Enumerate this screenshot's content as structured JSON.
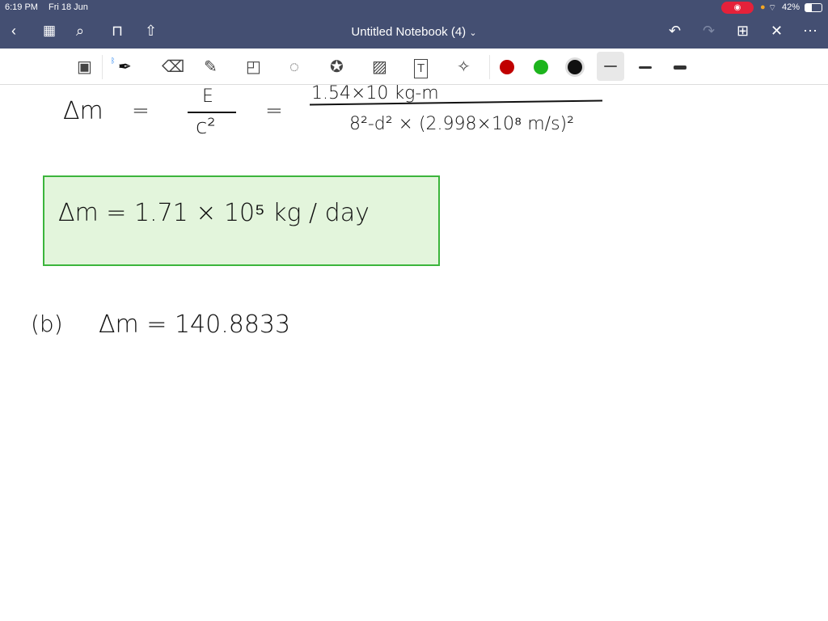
{
  "status": {
    "time": "6:19 PM",
    "date": "Fri 18 Jun",
    "battery": "42%"
  },
  "nav": {
    "title": "Untitled Notebook (4)",
    "chevron": "⌄"
  },
  "colors": {
    "red": "#c00000",
    "green": "#1db41d",
    "black": "#111111",
    "nav_bg": "#444f72",
    "box_bg": "#e3f5dc",
    "box_border": "#3cb53c"
  },
  "note": {
    "line1": {
      "lhs": "Δm",
      "eq1": "=",
      "num1": "E",
      "den1": "c²",
      "eq2": "=",
      "num2": "1.54×10 kg-m",
      "den2": "8²-d² × (2.998×10⁸ m/s)²"
    },
    "boxed": "Δm  =  1.71 × 10⁵ kg / day",
    "partb": {
      "label": "(b)",
      "expr": "Δm = 140.8833"
    }
  }
}
